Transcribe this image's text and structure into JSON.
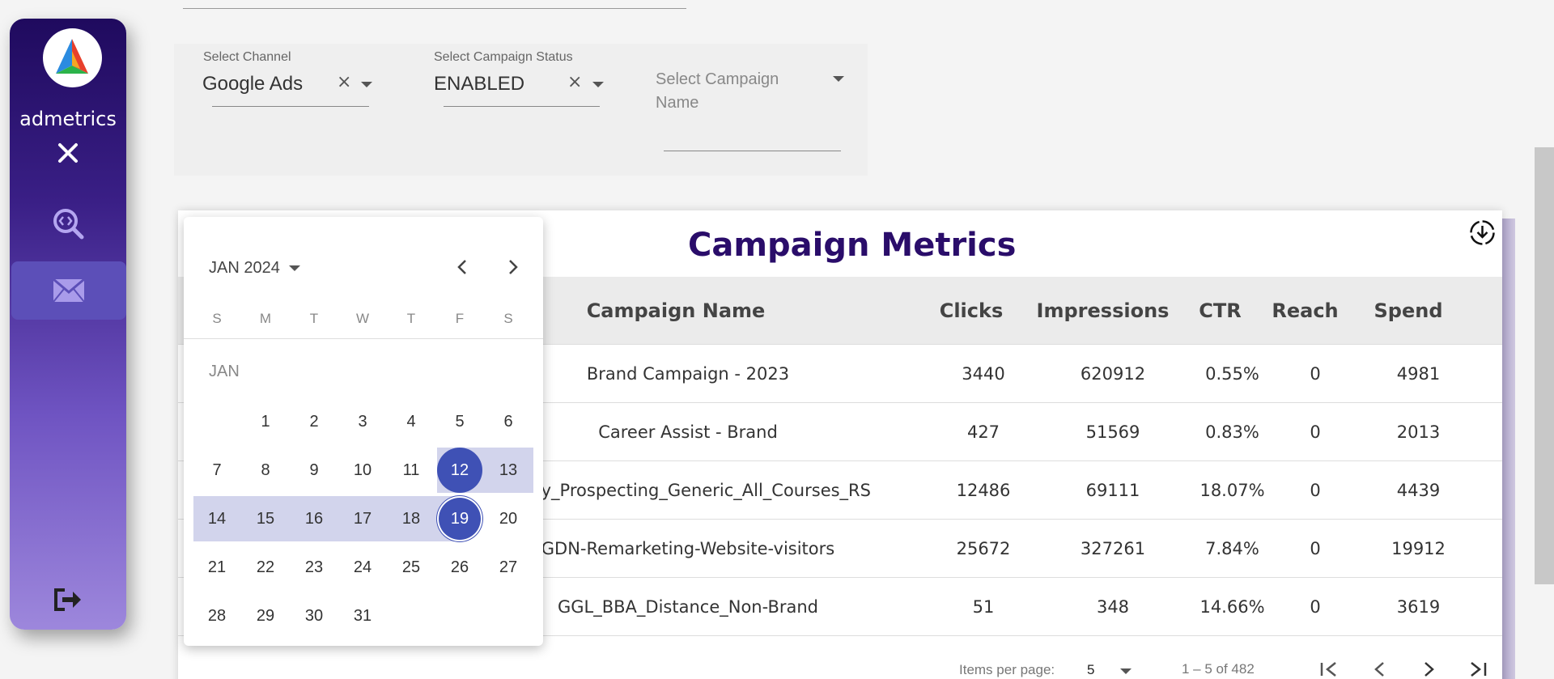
{
  "sidebar": {
    "brand": "admetrics",
    "colors": {
      "top": "#1f0a5e",
      "bottom": "#9d87dc",
      "active": "#5c4fb8"
    },
    "icons": [
      "close-icon",
      "search-code-icon",
      "mail-icon",
      "logout-icon"
    ]
  },
  "filters": {
    "channel": {
      "label": "Select Channel",
      "value": "Google Ads"
    },
    "status": {
      "label": "Select Campaign Status",
      "value": "ENABLED"
    },
    "campaign": {
      "placeholder": "Select Campaign Name"
    }
  },
  "metrics": {
    "title": "Campaign Metrics",
    "columns": [
      "Campaign Name",
      "Clicks",
      "Impressions",
      "CTR",
      "Reach",
      "Spend"
    ],
    "rows": [
      {
        "name": "Brand Campaign - 2023",
        "clicks": "3440",
        "impressions": "620912",
        "ctr": "0.55%",
        "reach": "0",
        "spend": "4981"
      },
      {
        "name": "Career Assist - Brand",
        "clicks": "427",
        "impressions": "51569",
        "ctr": "0.83%",
        "reach": "0",
        "spend": "2013"
      },
      {
        "name": "ry_Prospecting_Generic_All_Courses_RS",
        "clicks": "12486",
        "impressions": "69111",
        "ctr": "18.07%",
        "reach": "0",
        "spend": "4439"
      },
      {
        "name": "GDN-Remarketing-Website-visitors",
        "clicks": "25672",
        "impressions": "327261",
        "ctr": "7.84%",
        "reach": "0",
        "spend": "19912"
      },
      {
        "name": "GGL_BBA_Distance_Non-Brand",
        "clicks": "51",
        "impressions": "348",
        "ctr": "14.66%",
        "reach": "0",
        "spend": "3619"
      }
    ],
    "pager": {
      "items_label": "Items per page:",
      "items_value": "5",
      "range": "1 – 5 of 482"
    }
  },
  "calendar": {
    "month_label": "JAN 2024",
    "section_label": "JAN",
    "dow": [
      "S",
      "M",
      "T",
      "W",
      "T",
      "F",
      "S"
    ],
    "days": [
      "1",
      "2",
      "3",
      "4",
      "5",
      "6",
      "7",
      "8",
      "9",
      "10",
      "11",
      "12",
      "13",
      "14",
      "15",
      "16",
      "17",
      "18",
      "19",
      "20",
      "21",
      "22",
      "23",
      "24",
      "25",
      "26",
      "27",
      "28",
      "29",
      "30",
      "31"
    ],
    "range_start": "12",
    "range_end": "19",
    "colors": {
      "selected": "#3f51b5",
      "range": "#d2d4ec"
    }
  }
}
